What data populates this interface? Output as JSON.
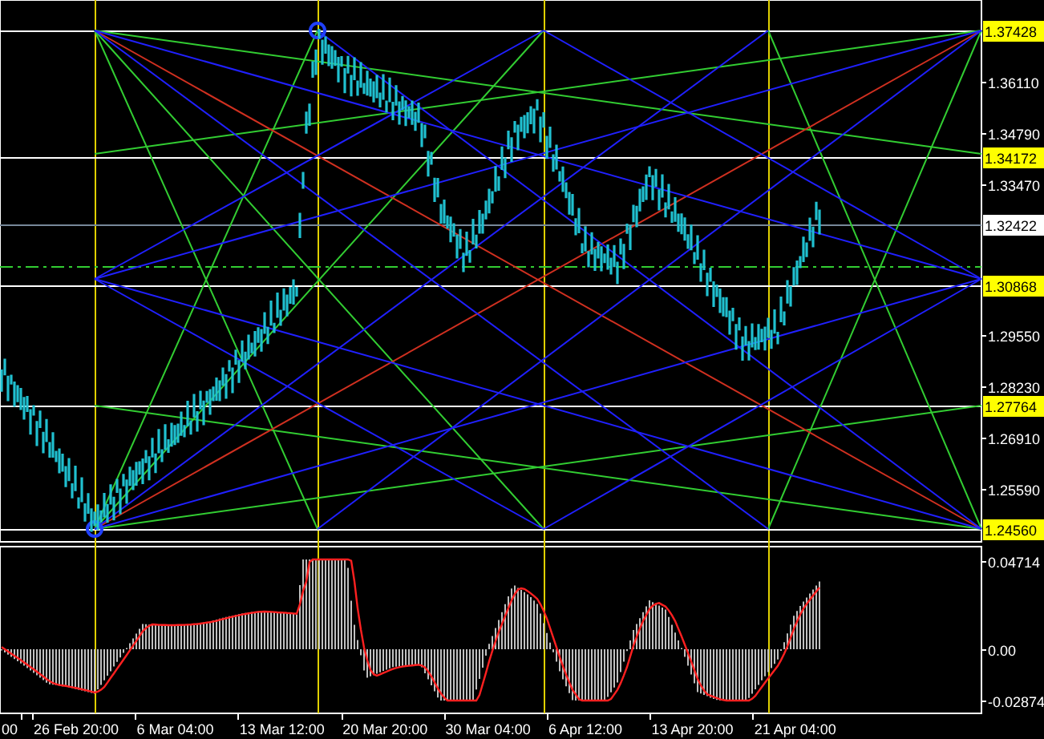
{
  "price_axis": {
    "labels": [
      {
        "text": "1.37428",
        "kind": "marker"
      },
      {
        "text": "1.36110",
        "kind": "tick"
      },
      {
        "text": "1.34790",
        "kind": "tick"
      },
      {
        "text": "1.34172",
        "kind": "marker"
      },
      {
        "text": "1.33470",
        "kind": "tick"
      },
      {
        "text": "1.32422",
        "kind": "current"
      },
      {
        "text": "1.30868",
        "kind": "marker"
      },
      {
        "text": "1.29550",
        "kind": "tick"
      },
      {
        "text": "1.28230",
        "kind": "tick"
      },
      {
        "text": "1.27764",
        "kind": "marker"
      },
      {
        "text": "1.26910",
        "kind": "tick"
      },
      {
        "text": "1.25590",
        "kind": "tick"
      },
      {
        "text": "1.24560",
        "kind": "marker"
      }
    ]
  },
  "indicator_axis": {
    "labels": [
      {
        "text": "0.04714",
        "kind": "max"
      },
      {
        "text": "0.00",
        "kind": "zero"
      },
      {
        "text": "-0.02874",
        "kind": "min"
      }
    ]
  },
  "time_axis": {
    "labels": [
      "00",
      "26 Feb 20:00",
      "6 Mar 04:00",
      "13 Mar 12:00",
      "20 Mar 20:00",
      "30 Mar 04:00",
      "6 Apr 12:00",
      "13 Apr 20:00",
      "21 Apr 04:00"
    ]
  }
}
